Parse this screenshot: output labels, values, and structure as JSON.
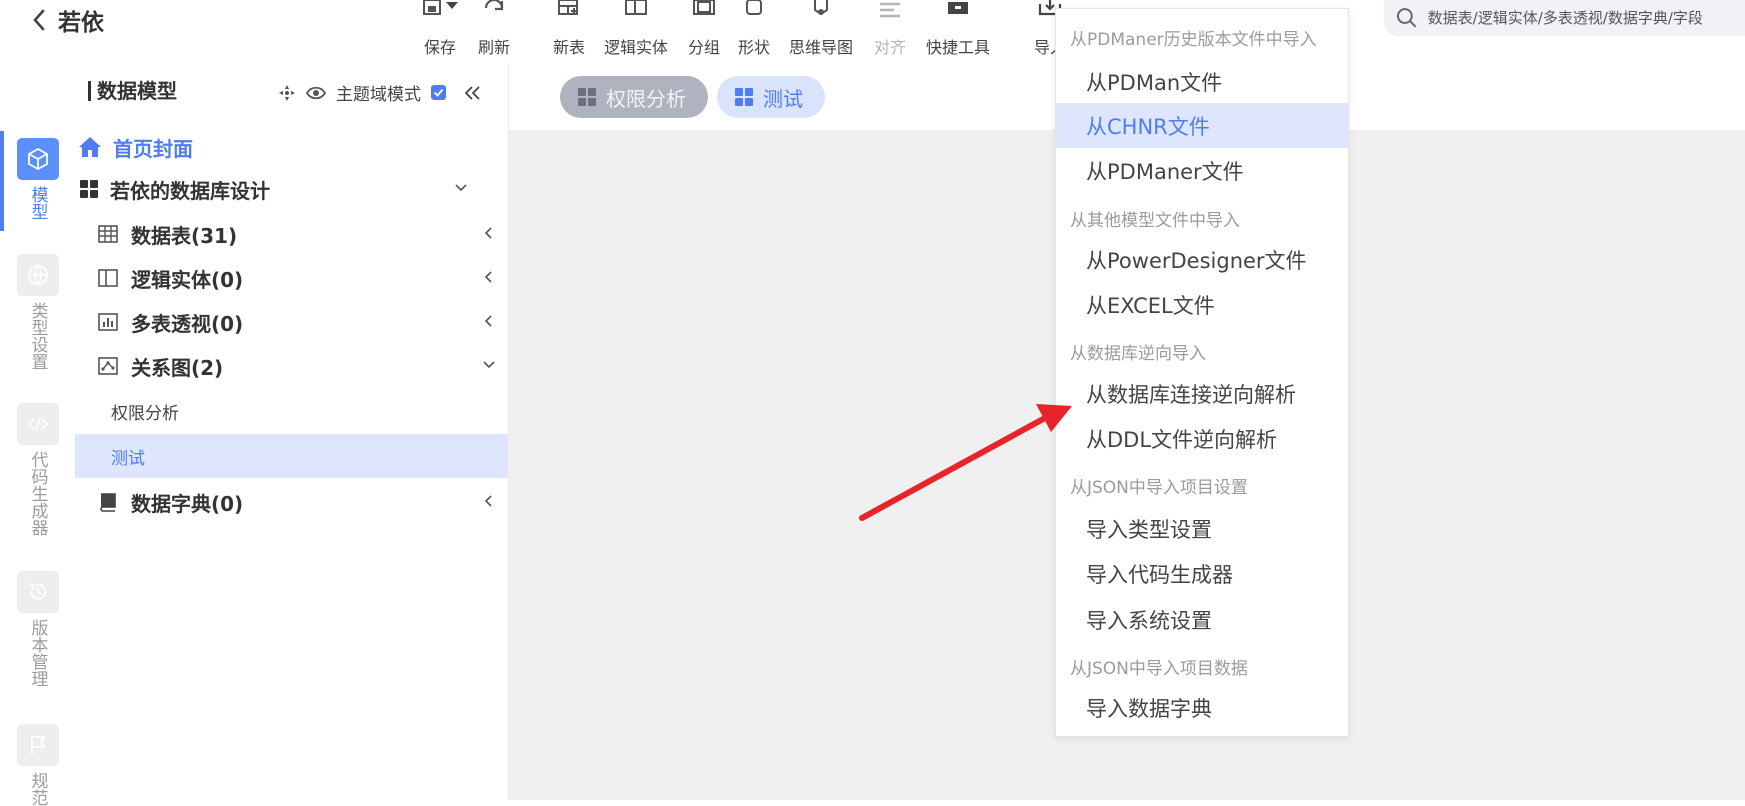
{
  "app": {
    "title": "若依"
  },
  "toolbar": {
    "items": [
      {
        "label": "保存",
        "icon": "save-icon"
      },
      {
        "label": "刷新",
        "icon": "refresh-icon"
      },
      {
        "label": "新表",
        "icon": "new-table-icon"
      },
      {
        "label": "逻辑实体",
        "icon": "logic-entity-icon"
      },
      {
        "label": "分组",
        "icon": "group-icon"
      },
      {
        "label": "形状",
        "icon": "shape-icon"
      },
      {
        "label": "思维导图",
        "icon": "mindmap-icon"
      },
      {
        "label": "对齐",
        "icon": "align-icon",
        "disabled": true
      },
      {
        "label": "快捷工具",
        "icon": "quick-tools-icon"
      },
      {
        "label": "导入",
        "icon": "import-icon"
      }
    ]
  },
  "search": {
    "placeholder": "数据表/逻辑实体/多表透视/数据字典/字段"
  },
  "rail": {
    "items": [
      {
        "label": "模型",
        "icon": "model-cube-icon",
        "active": true
      },
      {
        "label": "类型设置",
        "icon": "globe-icon"
      },
      {
        "label": "代码生成器",
        "icon": "code-icon"
      },
      {
        "label": "版本管理",
        "icon": "history-icon"
      },
      {
        "label": "规范",
        "icon": "flag-icon"
      }
    ]
  },
  "tree": {
    "title": "数据模型",
    "domain_mode_label": "主题域模式",
    "home_label": "首页封面",
    "project_label": "若依的数据库设计",
    "nodes": [
      {
        "label": "数据表(31)",
        "icon": "table-grid-icon"
      },
      {
        "label": "逻辑实体(0)",
        "icon": "logic-entity-icon"
      },
      {
        "label": "多表透视(0)",
        "icon": "bar-chart-icon"
      },
      {
        "label": "关系图(2)",
        "icon": "relation-diagram-icon"
      },
      {
        "label": "数据字典(0)",
        "icon": "book-icon"
      }
    ],
    "diagrams": [
      "权限分析",
      "测试"
    ],
    "selected_diagram": "测试"
  },
  "tabs": [
    {
      "label": "权限分析",
      "icon": "grid-icon"
    },
    {
      "label": "测试",
      "icon": "grid-icon",
      "active": true
    }
  ],
  "import_menu": {
    "groups": [
      {
        "title": "从PDManer历史版本文件中导入",
        "items": [
          "从PDMan文件",
          "从CHNR文件",
          "从PDManer文件"
        ]
      },
      {
        "title": "从其他模型文件中导入",
        "items": [
          "从PowerDesigner文件",
          "从EXCEL文件"
        ]
      },
      {
        "title": "从数据库逆向导入",
        "items": [
          "从数据库连接逆向解析",
          "从DDL文件逆向解析"
        ]
      },
      {
        "title": "从JSON中导入项目设置",
        "items": [
          "导入类型设置",
          "导入代码生成器",
          "导入系统设置"
        ]
      },
      {
        "title": "从JSON中导入项目数据",
        "items": [
          "导入数据字典"
        ]
      }
    ],
    "highlighted_item": "从CHNR文件"
  },
  "annotation": {
    "arrow_color": "#e8232a"
  },
  "colors": {
    "accent": "#4f7df0",
    "selection": "#dde6fd",
    "canvas": "#f0f0f1"
  }
}
